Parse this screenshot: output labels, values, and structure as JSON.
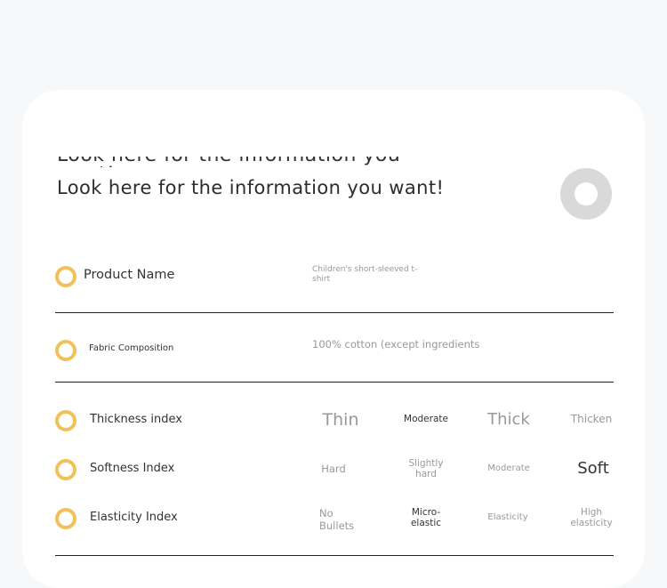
{
  "header": {
    "cut_text": "Look here for the information you want!",
    "headline": "Look here for the information you want!"
  },
  "rows": {
    "product_name": {
      "label": "Product Name",
      "value": "Children's short-sleeved t-shirt"
    },
    "fabric": {
      "label": "Fabric Composition",
      "value": "100% cotton (except ingredients"
    },
    "thickness": {
      "label": "Thickness index",
      "options": [
        "Thin",
        "Moderate",
        "Thick",
        "Thicken"
      ],
      "selected": "Moderate"
    },
    "softness": {
      "label": "Softness Index",
      "options": [
        "Hard",
        "Slightly hard",
        "Moderate",
        "Soft"
      ],
      "selected": "Soft"
    },
    "elasticity": {
      "label": "Elasticity Index",
      "options": [
        "No Bullets",
        "Micro-elastic",
        "Elasticity",
        "High elasticity"
      ],
      "selected": "Micro-elastic"
    }
  },
  "colors": {
    "accent_ring": "#f2c25a",
    "divider": "#222222",
    "muted": "#999999"
  },
  "icons": {
    "row_marker": "ring-icon",
    "header_marker": "ring-icon"
  }
}
